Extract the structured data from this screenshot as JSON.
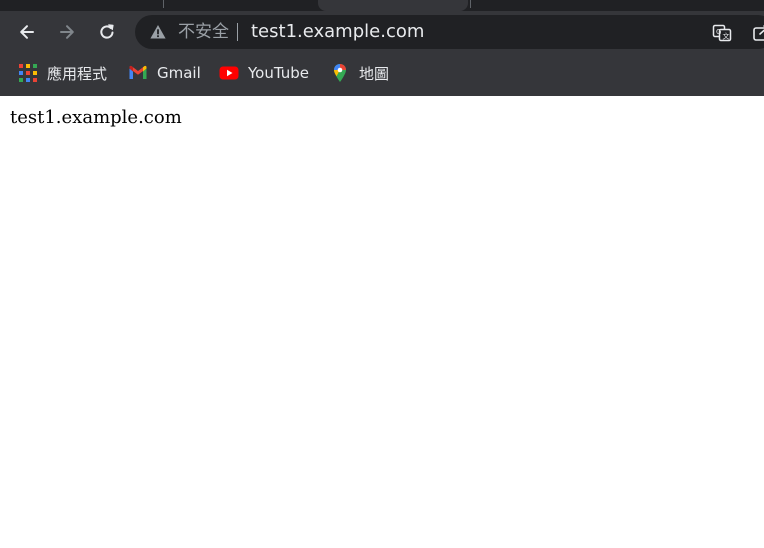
{
  "colors": {
    "chrome_bg": "#35363a",
    "omnibox_bg": "#202124",
    "toolbar_icon": "#e8eaed",
    "disabled_icon": "#80868b",
    "secondary_text": "#9aa0a6",
    "page_bg": "#ffffff"
  },
  "toolbar": {
    "back_icon": "arrow-left-icon",
    "forward_icon": "arrow-right-icon",
    "reload_icon": "reload-icon"
  },
  "omnibox": {
    "security_icon": "warning-triangle-icon",
    "security_label": "不安全",
    "url": "test1.example.com",
    "translate_icon": "translate-icon",
    "share_icon": "share-icon"
  },
  "bookmarks": [
    {
      "label": "應用程式",
      "icon": "apps-grid-icon"
    },
    {
      "label": "Gmail",
      "icon": "gmail-icon"
    },
    {
      "label": "YouTube",
      "icon": "youtube-icon"
    },
    {
      "label": "地圖",
      "icon": "maps-pin-icon"
    }
  ],
  "page": {
    "body_text": "test1.example.com"
  }
}
